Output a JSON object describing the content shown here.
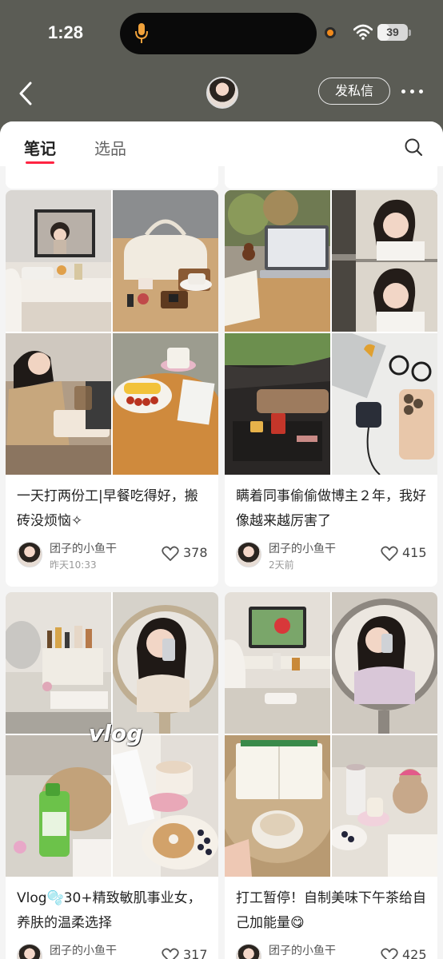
{
  "status_bar": {
    "time": "1:28",
    "battery": "39",
    "battery_level": 0.39,
    "record_color": "#f08a1c"
  },
  "header": {
    "back_icon": "chevron-left-icon",
    "dm_label": "发私信",
    "more_icon": "more-dots-icon"
  },
  "tabs": {
    "notes": "笔记",
    "products": "选品",
    "active": "notes",
    "accent_color": "#ff2442",
    "search_icon": "search-icon"
  },
  "cards": [
    {
      "title": "一天打两份工|早餐吃得好，搬砖没烦恼✧",
      "author": "团子的小鱼干",
      "time": "昨天10:33",
      "likes": "378"
    },
    {
      "title": "瞒着同事偷偷做博主２年，我好像越来越厉害了",
      "author": "团子的小鱼干",
      "time": "2天前",
      "likes": "415"
    },
    {
      "title": "Vlog🫧30+精致敏肌事业女，养肤的温柔选择",
      "author": "团子的小鱼干",
      "likes": "317",
      "overlay": "vlog"
    },
    {
      "title": "打工暂停！自制美味下午茶给自己加能量😋",
      "author": "团子的小鱼干",
      "likes": "425"
    }
  ]
}
